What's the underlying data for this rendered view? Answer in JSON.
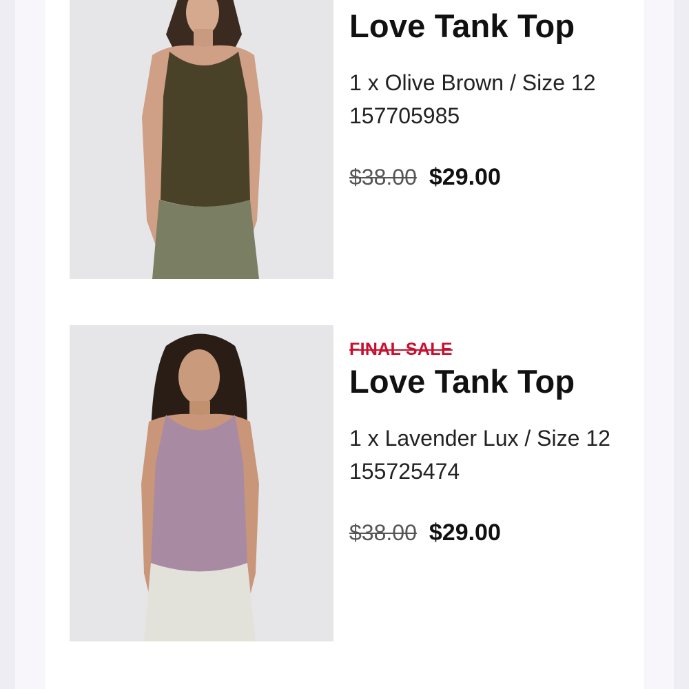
{
  "products": [
    {
      "badge": "",
      "title": "Love Tank Top",
      "variant": "1 x Olive Brown / Size 12",
      "sku": "157705985",
      "original_price": "$38.00",
      "sale_price": "$29.00",
      "image_alt": "Model wearing olive brown tank top",
      "top_color": "#4a4228",
      "bottom_color": "#7a7e62"
    },
    {
      "badge": "FINAL SALE",
      "title": "Love Tank Top",
      "variant": "1 x Lavender Lux / Size 12",
      "sku": "155725474",
      "original_price": "$38.00",
      "sale_price": "$29.00",
      "image_alt": "Model wearing lavender tank top",
      "top_color": "#a98aa3",
      "bottom_color": "#e3e2da"
    }
  ],
  "colors": {
    "final_sale": "#c8102e",
    "background": "#eeedf3",
    "card": "#ffffff"
  }
}
